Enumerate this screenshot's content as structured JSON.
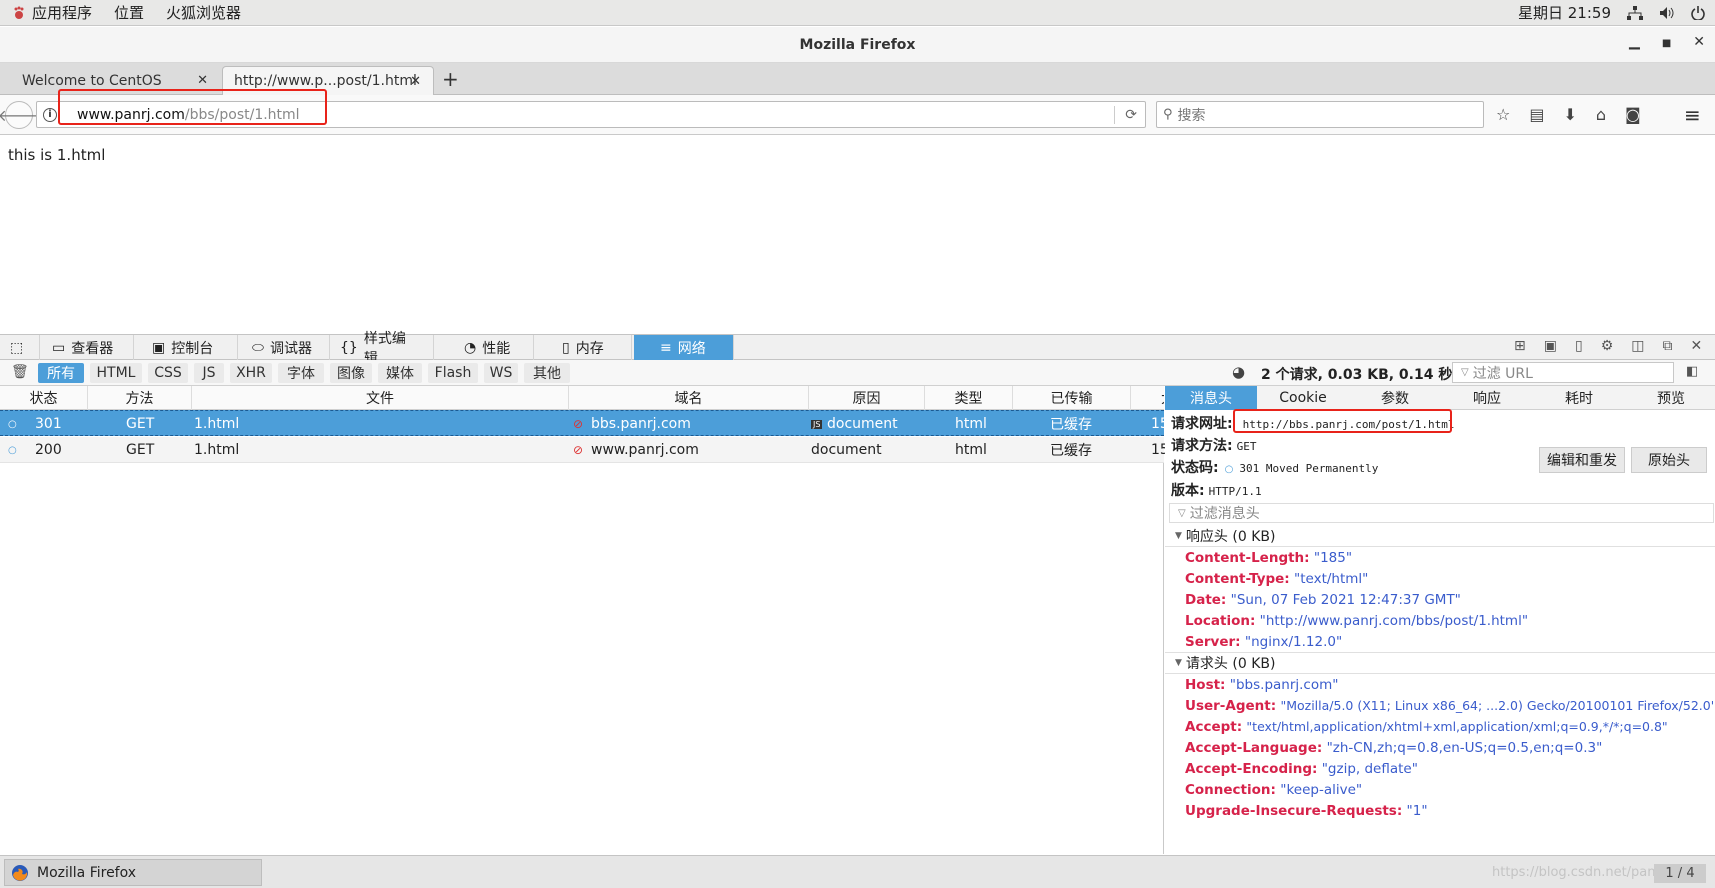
{
  "topbar": {
    "apps": "应用程序",
    "places": "位置",
    "browser": "火狐浏览器",
    "clock": "星期日 21:59"
  },
  "window": {
    "title": "Mozilla Firefox"
  },
  "tabs": [
    {
      "label": "Welcome to CentOS"
    },
    {
      "label": "http://www.p...post/1.html"
    }
  ],
  "nav": {
    "url_host": "www.panrj.com",
    "url_path": "/bbs/post/1.html",
    "search_placeholder": "搜索"
  },
  "page": {
    "text": "this is 1.html"
  },
  "devtools": {
    "tabs": [
      "查看器",
      "控制台",
      "调试器",
      "样式编辑...",
      "性能",
      "内存",
      "网络"
    ],
    "filters": [
      "所有",
      "HTML",
      "CSS",
      "JS",
      "XHR",
      "字体",
      "图像",
      "媒体",
      "Flash",
      "WS",
      "其他"
    ],
    "summary": "2 个请求, 0.03 KB, 0.14 秒",
    "filter_url_placeholder": "过滤 URL",
    "columns": [
      "状态",
      "方法",
      "文件",
      "域名",
      "原因",
      "类型",
      "已传输",
      "大"
    ],
    "rows": [
      {
        "status": "301",
        "method": "GET",
        "file": "1.html",
        "domain": "bbs.panrj.com",
        "cause": "document",
        "type": "html",
        "transferred": "已缓存",
        "size": "15"
      },
      {
        "status": "200",
        "method": "GET",
        "file": "1.html",
        "domain": "www.panrj.com",
        "cause": "document",
        "type": "html",
        "transferred": "已缓存",
        "size": "15"
      }
    ]
  },
  "details": {
    "tabs": [
      "消息头",
      "Cookie",
      "参数",
      "响应",
      "耗时",
      "预览"
    ],
    "request_url_label": "请求网址:",
    "request_url": "http://bbs.panrj.com/post/1.html",
    "request_method_label": "请求方法:",
    "request_method": "GET",
    "status_code_label": "状态码:",
    "status_code": "301 Moved Permanently",
    "version_label": "版本:",
    "version": "HTTP/1.1",
    "edit_resend": "编辑和重发",
    "raw_headers": "原始头",
    "filter_headers_placeholder": "过滤消息头",
    "response_section": "响应头 (0 KB)",
    "response_headers": [
      {
        "k": "Content-Length:",
        "v": "\"185\""
      },
      {
        "k": "Content-Type:",
        "v": "\"text/html\""
      },
      {
        "k": "Date:",
        "v": "\"Sun, 07 Feb 2021 12:47:37 GMT\""
      },
      {
        "k": "Location:",
        "v": "\"http://www.panrj.com/bbs/post/1.html\""
      },
      {
        "k": "Server:",
        "v": "\"nginx/1.12.0\""
      }
    ],
    "request_section": "请求头 (0 KB)",
    "request_headers": [
      {
        "k": "Host:",
        "v": "\"bbs.panrj.com\""
      },
      {
        "k": "User-Agent:",
        "v": "\"Mozilla/5.0 (X11; Linux x86_64; ...2.0) Gecko/20100101 Firefox/52.0\""
      },
      {
        "k": "Accept:",
        "v": "\"text/html,application/xhtml+xml,application/xml;q=0.9,*/*;q=0.8\""
      },
      {
        "k": "Accept-Language:",
        "v": "\"zh-CN,zh;q=0.8,en-US;q=0.5,en;q=0.3\""
      },
      {
        "k": "Accept-Encoding:",
        "v": "\"gzip, deflate\""
      },
      {
        "k": "Connection:",
        "v": "\"keep-alive\""
      },
      {
        "k": "Upgrade-Insecure-Requests:",
        "v": "\"1\""
      }
    ]
  },
  "taskbar": {
    "app": "Mozilla Firefox",
    "pager": "1 / 4",
    "watermark": "https://blog.csdn.net/panrj"
  },
  "colors": {
    "accent": "#4c9ed9",
    "highlight_box": "#e8231a",
    "header_key": "#d6224a",
    "header_value": "#3a5ccc"
  }
}
